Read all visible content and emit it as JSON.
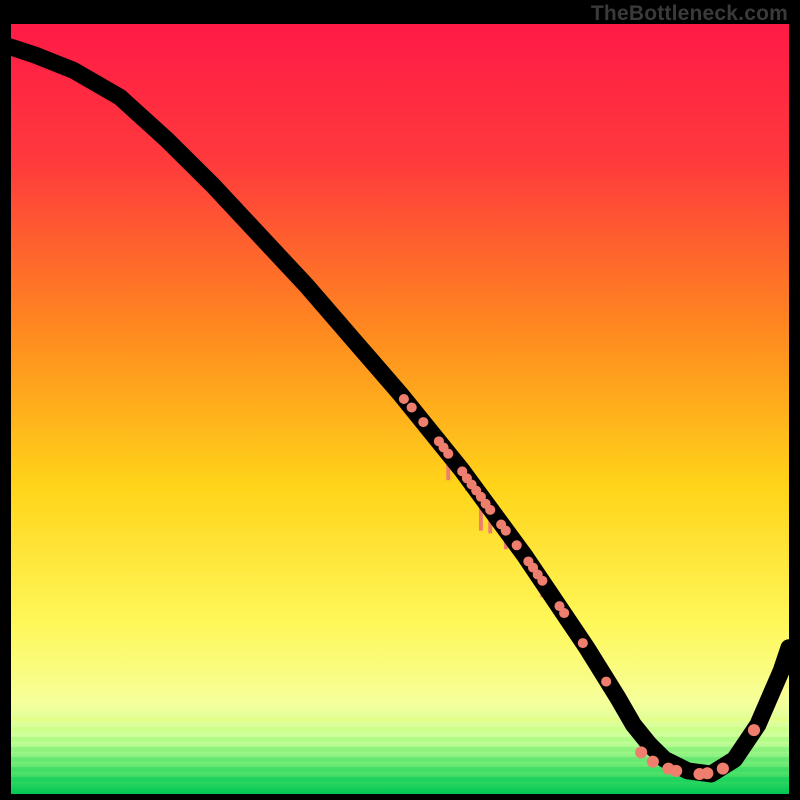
{
  "attribution": "TheBottleneck.com",
  "colors": {
    "gradient_top": "#ff1a47",
    "gradient_mid1": "#ff8a1f",
    "gradient_mid2": "#ffe218",
    "gradient_mid3": "#fdfe6e",
    "gradient_bottom": "#00d060",
    "marker": "#ee7e6e",
    "curve": "#000000"
  },
  "chart_data": {
    "type": "line",
    "title": "",
    "xlabel": "",
    "ylabel": "",
    "xlim": [
      0,
      100
    ],
    "ylim": [
      0,
      100
    ],
    "grid": false,
    "legend": false,
    "series": [
      {
        "name": "bottleneck-curve",
        "x": [
          0,
          3,
          8,
          14,
          20,
          26,
          32,
          38,
          44,
          50,
          54,
          58,
          62,
          66,
          70,
          74,
          78,
          80,
          82,
          84,
          87,
          90,
          93,
          96,
          99,
          100
        ],
        "y": [
          97,
          96,
          94,
          90.5,
          85,
          79,
          72.5,
          66,
          59,
          52,
          47,
          42,
          36.5,
          31,
          25,
          19,
          12.5,
          9,
          6.5,
          4.5,
          3,
          2.6,
          4.5,
          9,
          16,
          19
        ]
      }
    ],
    "markers": {
      "name": "highlighted-points",
      "points": [
        {
          "x": 50.5,
          "y": 51.3,
          "r": 5
        },
        {
          "x": 51.5,
          "y": 50.2,
          "r": 5
        },
        {
          "x": 53.0,
          "y": 48.3,
          "r": 5
        },
        {
          "x": 55.0,
          "y": 45.8,
          "r": 5
        },
        {
          "x": 55.6,
          "y": 45.0,
          "r": 5
        },
        {
          "x": 56.2,
          "y": 44.2,
          "r": 5
        },
        {
          "x": 58.0,
          "y": 41.9,
          "r": 5
        },
        {
          "x": 58.6,
          "y": 41.0,
          "r": 5
        },
        {
          "x": 59.2,
          "y": 40.2,
          "r": 5
        },
        {
          "x": 59.8,
          "y": 39.4,
          "r": 5
        },
        {
          "x": 60.4,
          "y": 38.6,
          "r": 5
        },
        {
          "x": 61.0,
          "y": 37.7,
          "r": 5
        },
        {
          "x": 61.6,
          "y": 36.9,
          "r": 5
        },
        {
          "x": 63.0,
          "y": 35.0,
          "r": 5
        },
        {
          "x": 63.6,
          "y": 34.2,
          "r": 5
        },
        {
          "x": 65.0,
          "y": 32.3,
          "r": 5
        },
        {
          "x": 66.5,
          "y": 30.2,
          "r": 5
        },
        {
          "x": 67.1,
          "y": 29.4,
          "r": 5
        },
        {
          "x": 67.7,
          "y": 28.5,
          "r": 5
        },
        {
          "x": 68.3,
          "y": 27.7,
          "r": 5
        },
        {
          "x": 70.5,
          "y": 24.4,
          "r": 5
        },
        {
          "x": 71.1,
          "y": 23.5,
          "r": 5
        },
        {
          "x": 73.5,
          "y": 19.6,
          "r": 5
        },
        {
          "x": 76.5,
          "y": 14.6,
          "r": 5
        },
        {
          "x": 81.0,
          "y": 5.4,
          "r": 6
        },
        {
          "x": 82.5,
          "y": 4.2,
          "r": 6
        },
        {
          "x": 84.5,
          "y": 3.3,
          "r": 6
        },
        {
          "x": 85.5,
          "y": 3.0,
          "r": 6
        },
        {
          "x": 88.5,
          "y": 2.6,
          "r": 6
        },
        {
          "x": 89.5,
          "y": 2.7,
          "r": 6
        },
        {
          "x": 91.5,
          "y": 3.3,
          "r": 6
        },
        {
          "x": 95.5,
          "y": 8.3,
          "r": 6
        }
      ]
    },
    "bars": {
      "name": "highlighted-bars",
      "items": [
        {
          "x": 56.2,
          "height": 3.5
        },
        {
          "x": 58.6,
          "height": 1.8
        },
        {
          "x": 60.4,
          "height": 4.5
        },
        {
          "x": 61.6,
          "height": 3.2
        },
        {
          "x": 63.6,
          "height": 2.5
        },
        {
          "x": 68.3,
          "height": 2.0
        }
      ]
    }
  }
}
